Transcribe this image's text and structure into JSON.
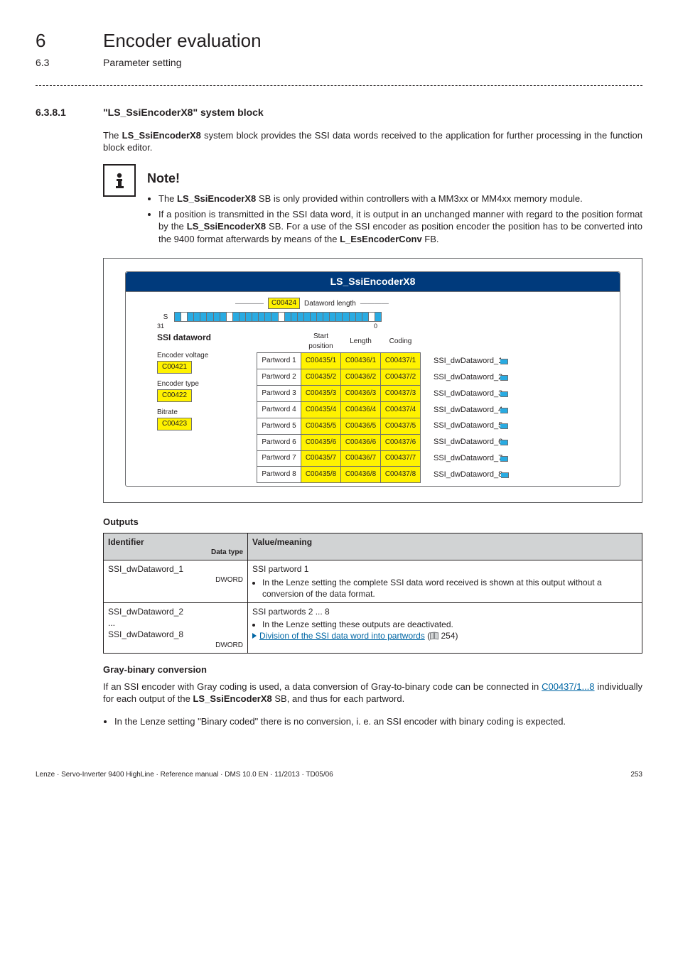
{
  "chapter": {
    "num": "6",
    "title": "Encoder evaluation"
  },
  "section": {
    "num": "6.3",
    "title": "Parameter setting"
  },
  "subsection": {
    "num": "6.3.8.1",
    "title": "\"LS_SsiEncoderX8\" system block"
  },
  "intro": "The LS_SsiEncoderX8 system block provides the SSI data words received to the application for further processing in the function block editor.",
  "intro_bold": "LS_SsiEncoderX8",
  "note": {
    "heading": "Note!",
    "items": [
      "The LS_SsiEncoderX8 SB is only provided within controllers with a MM3xx or MM4xx memory module.",
      "If a position is transmitted in the SSI data word, it is output in an unchanged manner with regard to the position format by the LS_SsiEncoderX8 SB. For a use of the SSI encoder as position encoder the position has to be converted into the 9400 format afterwards by means of the L_EsEncoderConv FB."
    ],
    "bold_tokens": [
      "LS_SsiEncoderX8",
      "L_EsEncoderConv"
    ]
  },
  "diagram": {
    "title": "LS_SsiEncoderX8",
    "dw_len_param": "C00424",
    "dw_len_label": "Dataword length",
    "bit_hi": "31",
    "bit_lo": "0",
    "s_label": "S",
    "left_heading": "SSI dataword",
    "col_headers": [
      "Start position",
      "Length",
      "Coding"
    ],
    "left_params": [
      {
        "label": "Encoder voltage",
        "code": "C00421"
      },
      {
        "label": "Encoder type",
        "code": "C00422"
      },
      {
        "label": "Bitrate",
        "code": "C00423"
      }
    ],
    "rows": [
      {
        "pw": "Partword 1",
        "sp": "C00435/1",
        "len": "C00436/1",
        "cod": "C00437/1",
        "out": "SSI_dwDataword_1"
      },
      {
        "pw": "Partword 2",
        "sp": "C00435/2",
        "len": "C00436/2",
        "cod": "C00437/2",
        "out": "SSI_dwDataword_2"
      },
      {
        "pw": "Partword 3",
        "sp": "C00435/3",
        "len": "C00436/3",
        "cod": "C00437/3",
        "out": "SSI_dwDataword_3"
      },
      {
        "pw": "Partword 4",
        "sp": "C00435/4",
        "len": "C00436/4",
        "cod": "C00437/4",
        "out": "SSI_dwDataword_4"
      },
      {
        "pw": "Partword 5",
        "sp": "C00435/5",
        "len": "C00436/5",
        "cod": "C00437/5",
        "out": "SSI_dwDataword_5"
      },
      {
        "pw": "Partword 6",
        "sp": "C00435/6",
        "len": "C00436/6",
        "cod": "C00437/6",
        "out": "SSI_dwDataword_6"
      },
      {
        "pw": "Partword 7",
        "sp": "C00435/7",
        "len": "C00436/7",
        "cod": "C00437/7",
        "out": "SSI_dwDataword_7"
      },
      {
        "pw": "Partword 8",
        "sp": "C00435/8",
        "len": "C00436/8",
        "cod": "C00437/8",
        "out": "SSI_dwDataword_8"
      }
    ]
  },
  "outputs_heading": "Outputs",
  "outputs_table": {
    "headers": {
      "id": "Identifier",
      "dtype": "Data type",
      "val": "Value/meaning"
    },
    "rows": [
      {
        "id": "SSI_dwDataword_1",
        "dtype": "DWORD",
        "title": "SSI partword 1",
        "bullets": [
          "In the Lenze setting the complete SSI data word received is shown at this output without a conversion of the data format."
        ]
      },
      {
        "id_lines": [
          "SSI_dwDataword_2",
          "...",
          "SSI_dwDataword_8"
        ],
        "dtype": "DWORD",
        "title": "SSI partwords 2 ... 8",
        "bullets": [
          "In the Lenze setting these outputs are deactivated."
        ],
        "link_text": "Division of the SSI data word into partwords",
        "link_page": "254"
      }
    ]
  },
  "gray": {
    "heading": "Gray-binary conversion",
    "para_pre": "If an SSI encoder with Gray coding is used, a data conversion of Gray-to-binary code can be connected in ",
    "para_link": "C00437/1...8",
    "para_post": " individually for each output of the LS_SsiEncoderX8 SB, and thus for each partword.",
    "bullet": "In the Lenze setting \"Binary coded\" there is no conversion, i. e. an SSI encoder with binary coding is expected."
  },
  "footer": {
    "left": "Lenze · Servo-Inverter 9400 HighLine · Reference manual · DMS 10.0 EN · 11/2013 · TD05/06",
    "right": "253"
  }
}
